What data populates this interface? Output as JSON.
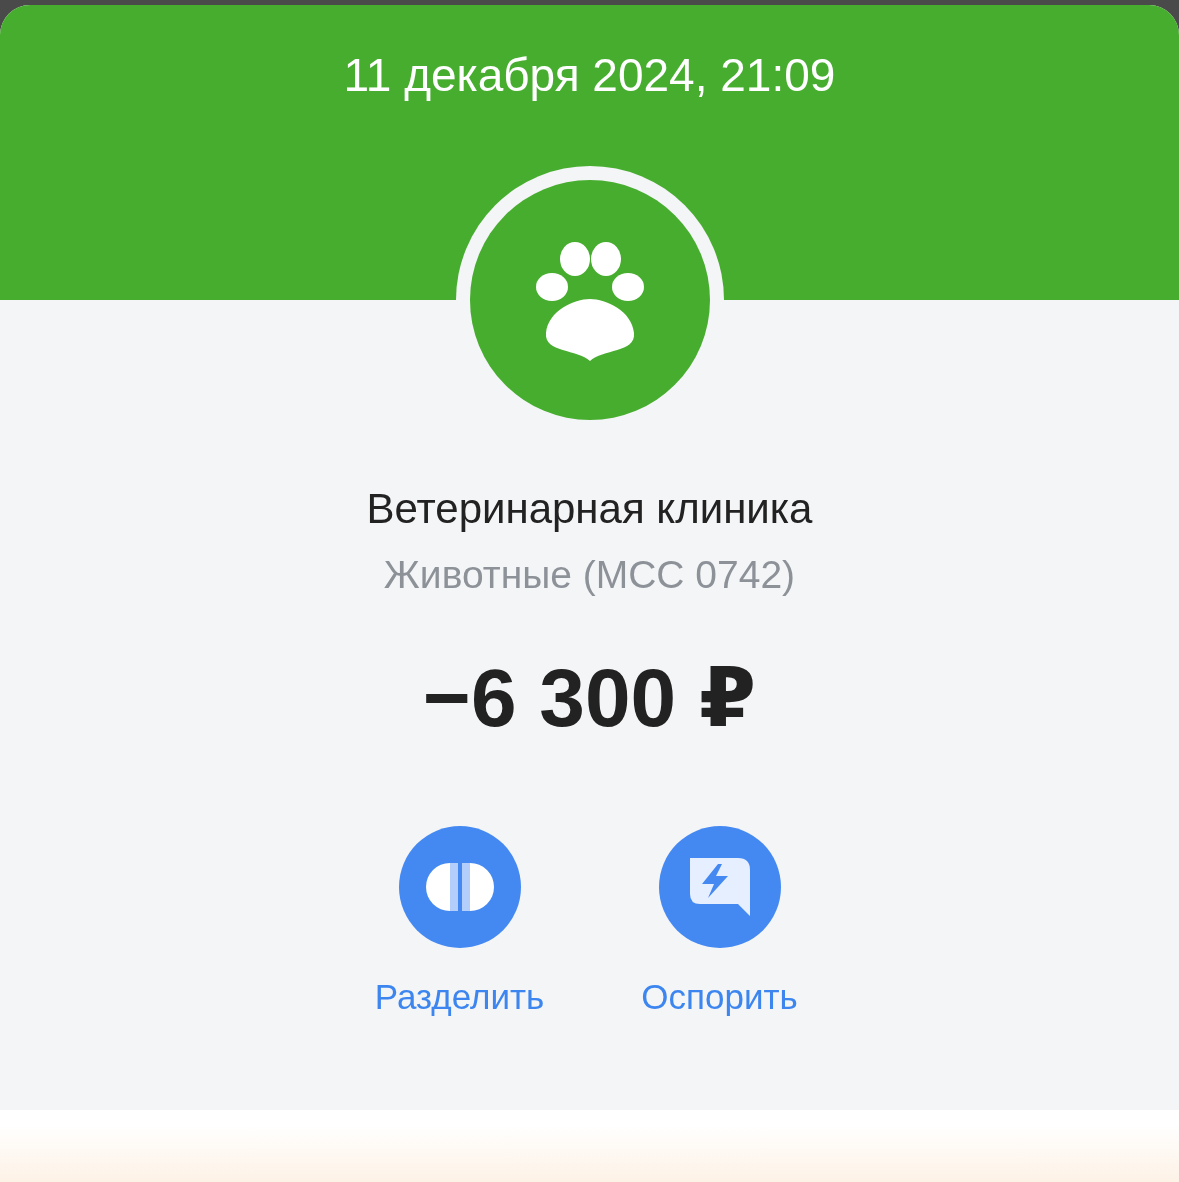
{
  "header": {
    "date": "11 декабря 2024, 21:09"
  },
  "merchant": {
    "name": "Ветеринарная клиника",
    "category": "Животные (MCC 0742)"
  },
  "amount": "−6 300 ₽",
  "actions": [
    {
      "kind": "split",
      "label": "Разделить"
    },
    {
      "kind": "dispute",
      "label": "Оспорить"
    }
  ]
}
